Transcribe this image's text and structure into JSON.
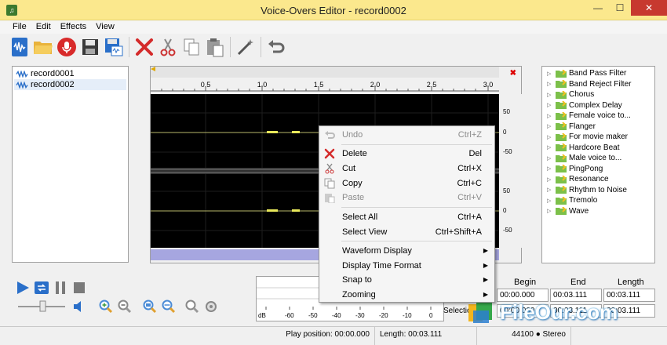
{
  "window": {
    "title": "Voice-Overs Editor - record0002",
    "min_label": "—",
    "max_label": "☐",
    "close_label": "✕"
  },
  "menu": [
    "File",
    "Edit",
    "Effects",
    "View"
  ],
  "toolbar_icons": [
    "new-record-icon",
    "open-folder-icon",
    "record-mic-icon",
    "save-icon",
    "save-as-icon",
    "delete-icon",
    "cut-icon",
    "copy-icon",
    "paste-icon",
    "magic-wand-icon",
    "undo-icon"
  ],
  "records": [
    "record0001",
    "record0002"
  ],
  "ruler": [
    "0.5",
    "1.0",
    "1.5",
    "2.0",
    "2.5",
    "3.0"
  ],
  "scale": [
    "50",
    "0",
    "-50",
    "50",
    "0",
    "-50"
  ],
  "effects": [
    "Band Pass Filter",
    "Band Reject Filter",
    "Chorus",
    "Complex Delay",
    "Female voice to...",
    "Flanger",
    "For movie maker",
    "Hardcore Beat",
    "Male voice to...",
    "PingPong",
    "Resonance",
    "Rhythm to Noise",
    "Tremolo",
    "Wave"
  ],
  "context_menu": {
    "undo": {
      "label": "Undo",
      "shortcut": "Ctrl+Z"
    },
    "delete": {
      "label": "Delete",
      "shortcut": "Del"
    },
    "cut": {
      "label": "Cut",
      "shortcut": "Ctrl+X"
    },
    "copy": {
      "label": "Copy",
      "shortcut": "Ctrl+C"
    },
    "paste": {
      "label": "Paste",
      "shortcut": "Ctrl+V"
    },
    "select_all": {
      "label": "Select All",
      "shortcut": "Ctrl+A"
    },
    "select_view": {
      "label": "Select View",
      "shortcut": "Ctrl+Shift+A"
    },
    "waveform_display": {
      "label": "Waveform Display"
    },
    "time_format": {
      "label": "Display Time Format"
    },
    "snap_to": {
      "label": "Snap to"
    },
    "zooming": {
      "label": "Zooming"
    }
  },
  "meter": {
    "db_labels": [
      "dB",
      "-60",
      "-50",
      "-40",
      "-30",
      "-20",
      "-10",
      "0"
    ]
  },
  "selection": {
    "headers": [
      "Begin",
      "End",
      "Length"
    ],
    "row1_label": "",
    "row1": [
      "00:00.000",
      "00:03.111",
      "00:03.111"
    ],
    "row2_label": "Selection",
    "row2": [
      "00:00.000",
      "00:03.111",
      "00:03.111"
    ]
  },
  "status": {
    "play_position": "Play position: 00:00.000",
    "length": "Length: 00:03.111",
    "format": "44100 ● Stereo"
  },
  "watermark": "FileOur.com",
  "colors": {
    "titlebar": "#fbe88d",
    "close": "#c7392f",
    "waveform_bg": "#000000",
    "waveform_line": "#e8e85a",
    "scroll": "#a6a6e0",
    "play_blue": "#2a6fc9"
  }
}
